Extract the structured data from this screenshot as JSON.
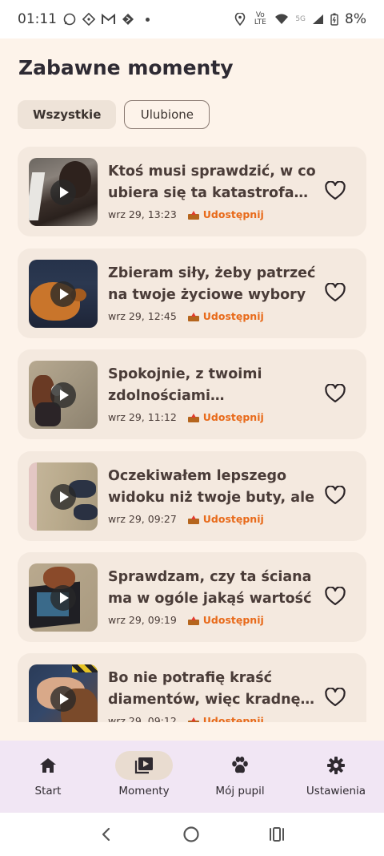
{
  "status_bar": {
    "time": "01:11",
    "volte": "Vo LTE",
    "signal_label": "5G",
    "battery": "8%"
  },
  "page": {
    "title": "Zabawne momenty"
  },
  "filters": [
    {
      "label": "Wszystkie",
      "active": true
    },
    {
      "label": "Ulubione",
      "active": false
    }
  ],
  "moments": [
    {
      "title": "Ktoś musi sprawdzić, w co ubiera się ta katastrofa modowa",
      "date": "wrz 29, 13:23",
      "share": "Udostępnij",
      "thumb": "dark-dog-photo"
    },
    {
      "title": "Zbieram siły, żeby patrzeć na twoje życiowe wybory",
      "date": "wrz 29, 12:45",
      "share": "Udostępnij",
      "thumb": "ginger-dog-on-couch"
    },
    {
      "title": "Spokojnie, z twoimi zdolnościami negocjacyjnymi",
      "date": "wrz 29, 11:12",
      "share": "Udostępnij",
      "thumb": "dog-with-toy"
    },
    {
      "title": "Oczekiwałem lepszego widoku niż twoje buty, ale",
      "date": "wrz 29, 09:27",
      "share": "Udostępnij",
      "thumb": "floor-and-shoes"
    },
    {
      "title": "Sprawdzam, czy ta ściana ma w ogóle jakąś wartość",
      "date": "wrz 29, 09:19",
      "share": "Udostępnij",
      "thumb": "dog-near-bag"
    },
    {
      "title": "Bo nie potrafię kraść diamentów, więc kradnę serca",
      "date": "wrz 29, 09:12",
      "share": "Udostępnij",
      "thumb": "hand-petting-dog"
    }
  ],
  "bottom_nav": [
    {
      "label": "Start",
      "icon": "home-icon",
      "active": false
    },
    {
      "label": "Momenty",
      "icon": "video-library-icon",
      "active": true
    },
    {
      "label": "Mój pupil",
      "icon": "paw-icon",
      "active": false
    },
    {
      "label": "Ustawienia",
      "icon": "gear-icon",
      "active": false
    }
  ],
  "colors": {
    "background": "#fdf3ea",
    "card": "#f4e9df",
    "accent": "#e86a1a",
    "nav_background": "#f1e6f4"
  }
}
